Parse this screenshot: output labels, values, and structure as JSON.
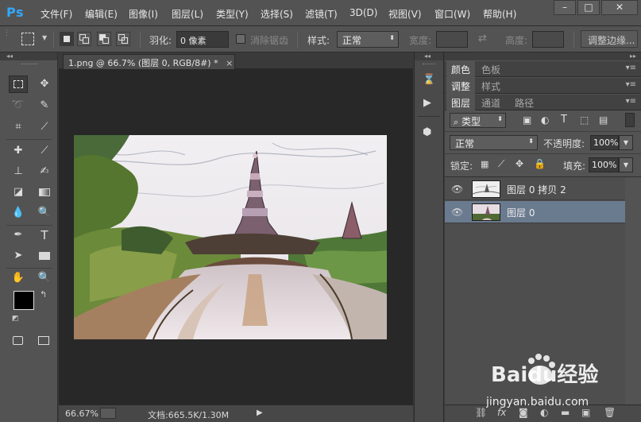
{
  "app": {
    "logo": "Ps"
  },
  "menu": [
    "文件(F)",
    "编辑(E)",
    "图像(I)",
    "图层(L)",
    "类型(Y)",
    "选择(S)",
    "滤镜(T)",
    "3D(D)",
    "视图(V)",
    "窗口(W)",
    "帮助(H)"
  ],
  "window_controls": {
    "minimize": "–",
    "maximize": "□",
    "close": "✕"
  },
  "options": {
    "feather_label": "羽化:",
    "feather_value": "0 像素",
    "antialias_label": "消除锯齿",
    "style_label": "样式:",
    "style_value": "正常",
    "width_label": "宽度:",
    "height_label": "高度:",
    "refine_edge": "调整边缘..."
  },
  "document": {
    "tab_title": "1.png @ 66.7% (图层 0, RGB/8#) *",
    "close_glyph": "×",
    "zoom": "66.67%",
    "doc_info": "文档:665.5K/1.30M"
  },
  "panels": {
    "group1_tabs": [
      "颜色",
      "色板"
    ],
    "group2_tabs": [
      "调整",
      "样式"
    ],
    "group3_tabs": [
      "图层",
      "通道",
      "路径"
    ],
    "filter_kind": "类型",
    "blend_mode": "正常",
    "opacity_label": "不透明度:",
    "opacity_value": "100%",
    "lock_label": "锁定:",
    "fill_label": "填充:",
    "fill_value": "100%",
    "layers": [
      {
        "name": "图层 0 拷贝 2",
        "selected": false
      },
      {
        "name": "图层 0",
        "selected": true
      }
    ],
    "bottom_buttons": [
      "link",
      "fx",
      "mask",
      "adjust",
      "group",
      "new",
      "delete"
    ]
  },
  "watermark": {
    "text": "Baidu经验",
    "url": "jingyan.baidu.com"
  },
  "colors": {
    "accent": "#31a8ff",
    "ui_bg": "#535353",
    "canvas_bg": "#282828",
    "selection": "#6a7a8f"
  }
}
